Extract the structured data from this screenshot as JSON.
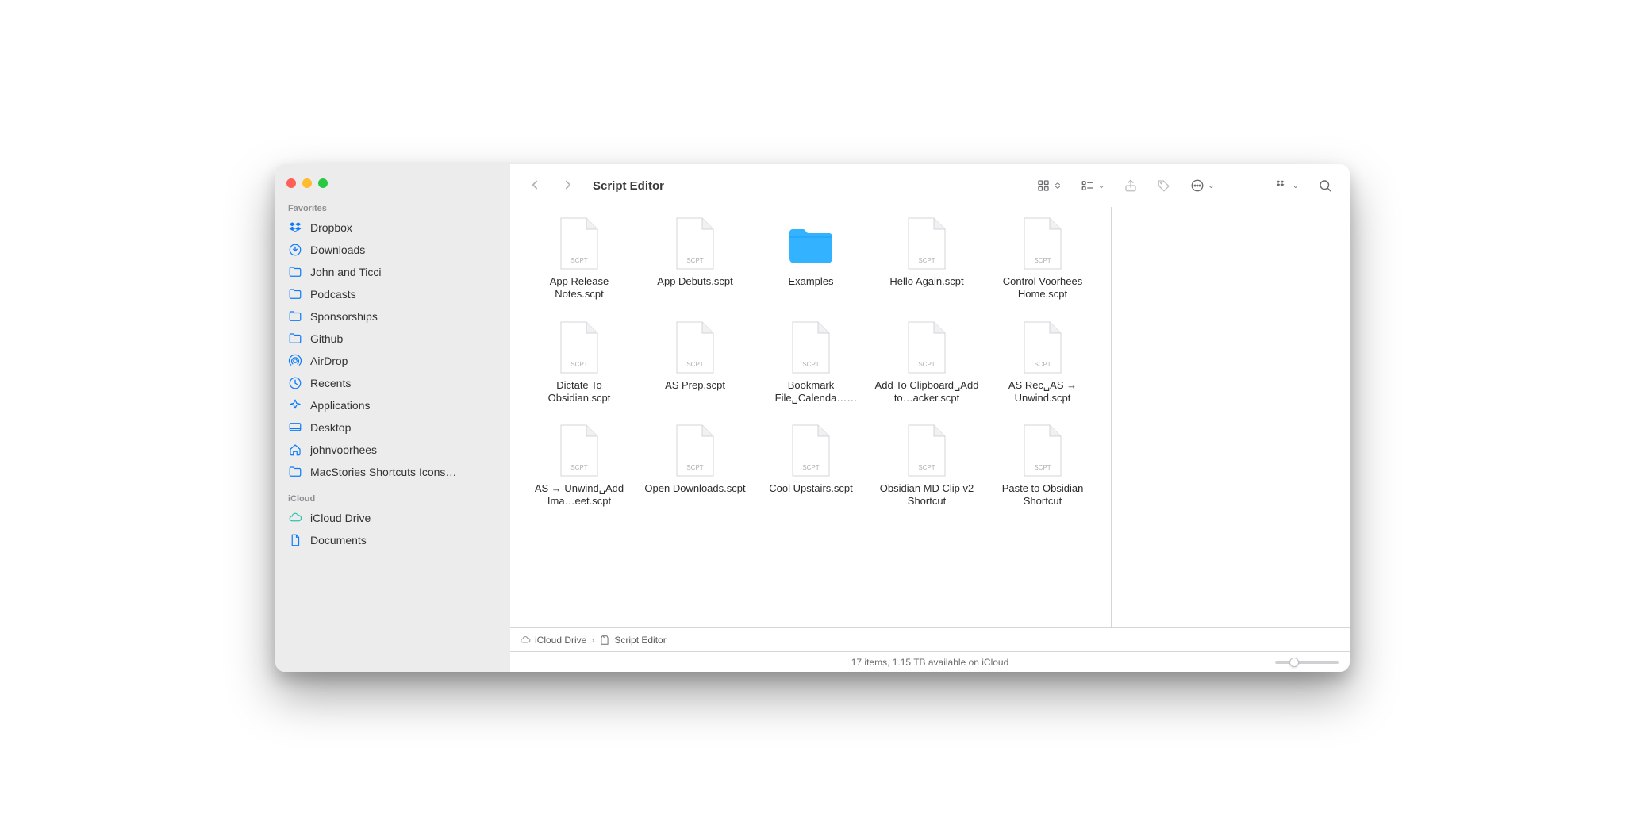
{
  "window": {
    "title": "Script Editor"
  },
  "sidebar": {
    "section_favorites": "Favorites",
    "section_icloud": "iCloud",
    "favorites": [
      {
        "icon": "dropbox",
        "label": "Dropbox"
      },
      {
        "icon": "download",
        "label": "Downloads"
      },
      {
        "icon": "folder",
        "label": "John and Ticci"
      },
      {
        "icon": "folder",
        "label": "Podcasts"
      },
      {
        "icon": "folder",
        "label": "Sponsorships"
      },
      {
        "icon": "folder",
        "label": "Github"
      },
      {
        "icon": "airdrop",
        "label": "AirDrop"
      },
      {
        "icon": "recents",
        "label": "Recents"
      },
      {
        "icon": "applications",
        "label": "Applications"
      },
      {
        "icon": "desktop",
        "label": "Desktop"
      },
      {
        "icon": "home",
        "label": "johnvoorhees"
      },
      {
        "icon": "folder",
        "label": "MacStories Shortcuts Icons…"
      }
    ],
    "icloud": [
      {
        "icon": "cloud",
        "label": "iCloud Drive",
        "tint": "teal"
      },
      {
        "icon": "doc",
        "label": "Documents"
      }
    ]
  },
  "pathbar": {
    "seg1": "iCloud Drive",
    "seg2": "Script Editor"
  },
  "status": {
    "text": "17 items, 1.15 TB available on iCloud"
  },
  "files": [
    {
      "type": "scpt",
      "name": "App Release Notes.scpt"
    },
    {
      "type": "scpt",
      "name": "App Debuts.scpt"
    },
    {
      "type": "folder",
      "name": "Examples"
    },
    {
      "type": "scpt",
      "name": "Hello Again.scpt"
    },
    {
      "type": "scpt",
      "name": "Control Voorhees Home.scpt"
    },
    {
      "type": "scpt",
      "name": "Dictate To Obsidian.scpt"
    },
    {
      "type": "scpt",
      "name": "AS Prep.scpt"
    },
    {
      "type": "scpt",
      "name": "Bookmark File␣Calenda…ons.scpt"
    },
    {
      "type": "scpt",
      "name": "Add To Clipboard␣Add to…acker.scpt"
    },
    {
      "type": "scpt",
      "name": "AS Rec␣AS → Unwind.scpt"
    },
    {
      "type": "scpt",
      "name": "AS → Unwind␣Add Ima…eet.scpt"
    },
    {
      "type": "scpt",
      "name": "Open Downloads.scpt"
    },
    {
      "type": "scpt",
      "name": "Cool Upstairs.scpt"
    },
    {
      "type": "scpt",
      "name": "Obsidian MD Clip v2 Shortcut"
    },
    {
      "type": "scpt",
      "name": "Paste to Obsidian Shortcut"
    }
  ],
  "file_ext_label": "SCPT"
}
